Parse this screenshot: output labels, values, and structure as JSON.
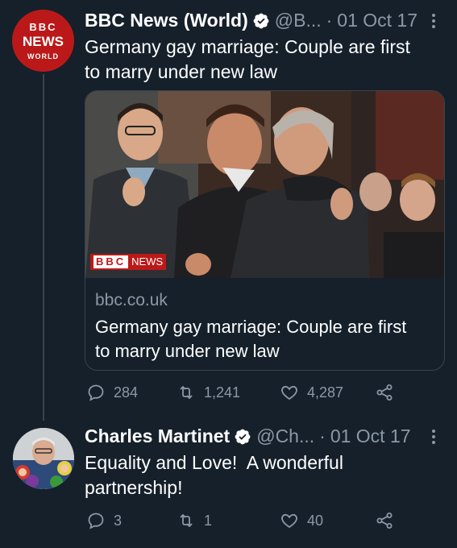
{
  "tweets": [
    {
      "name": "BBC News (World)",
      "handle": "@B...",
      "separator": "·",
      "date": "01 Oct 17",
      "text_line1": "Germany gay marriage: Couple are first",
      "text_line2": "to marry under new law",
      "avatar": {
        "line1": "BBC",
        "line2": "NEWS",
        "line3": "WORLD"
      },
      "card": {
        "domain": "bbc.co.uk",
        "title_line1": "Germany gay marriage: Couple are first",
        "title_line2": "to marry under new law",
        "overlay_brand": "BBC",
        "overlay_news": "NEWS"
      },
      "actions": {
        "replies": "284",
        "retweets": "1,241",
        "likes": "4,287"
      }
    },
    {
      "name": "Charles Martinet",
      "handle": "@Ch...",
      "separator": "·",
      "date": "01 Oct 17",
      "text_line1": "Equality and Love!  A wonderful",
      "text_line2": "partnership!",
      "actions": {
        "replies": "3",
        "retweets": "1",
        "likes": "40"
      }
    }
  ],
  "colors": {
    "background": "#15202b",
    "secondary_text": "#8b98a5",
    "verified": "#1d9bf0",
    "bbc_red": "#bb1919"
  }
}
